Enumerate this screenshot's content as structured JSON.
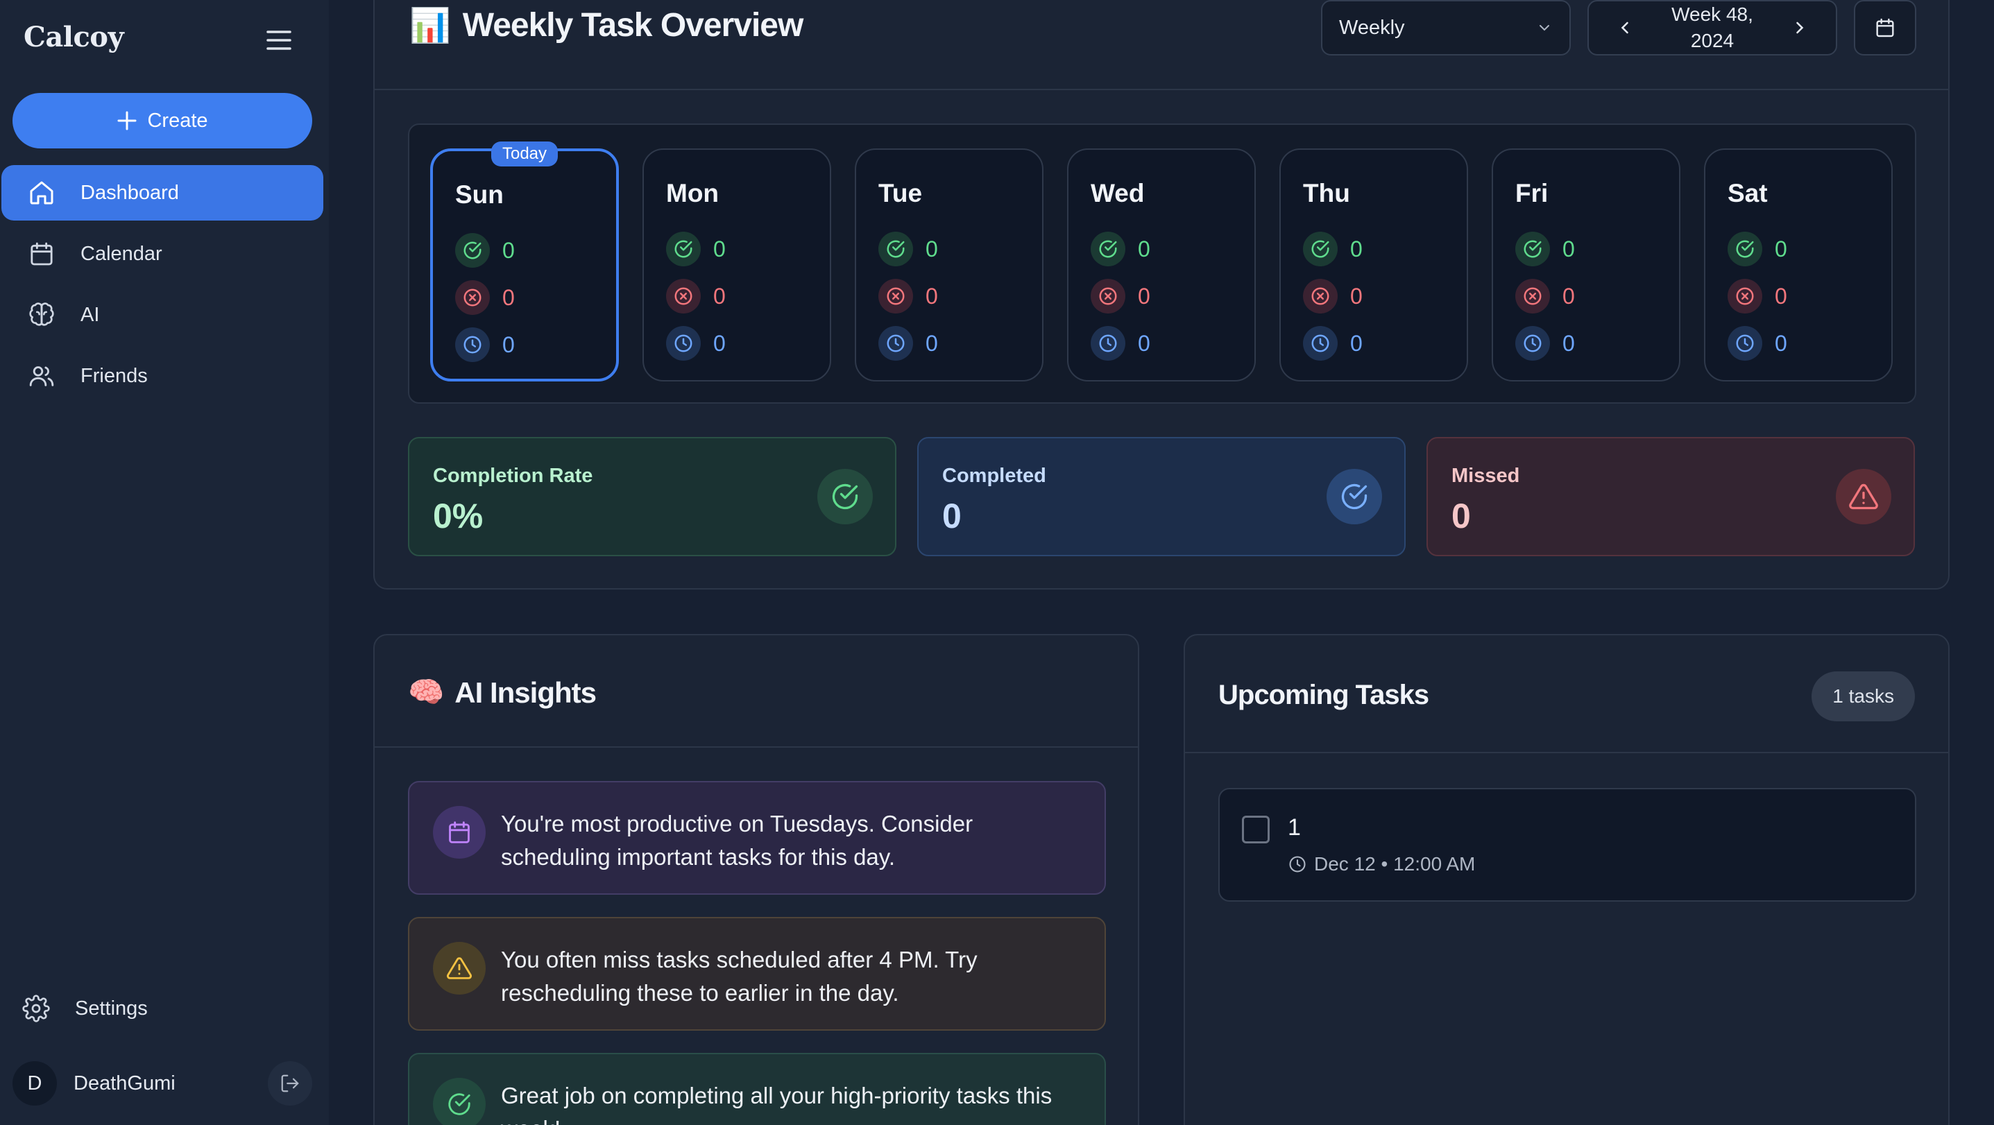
{
  "app": {
    "logo": "Calcoy",
    "create_label": "Create",
    "nav": [
      {
        "label": "Dashboard",
        "icon": "home-icon",
        "active": true
      },
      {
        "label": "Calendar",
        "icon": "calendar-icon",
        "active": false
      },
      {
        "label": "AI",
        "icon": "brain-icon",
        "active": false
      },
      {
        "label": "Friends",
        "icon": "users-icon",
        "active": false
      }
    ],
    "settings_label": "Settings",
    "user": {
      "initial": "D",
      "name": "DeathGumi"
    },
    "accent": "#3e7ef0"
  },
  "overview": {
    "title": "Weekly Task Overview",
    "title_icon": "📊",
    "view_select": "Weekly",
    "week_label_line1": "Week 48,",
    "week_label_line2": "2024",
    "today_badge": "Today",
    "days": [
      {
        "name": "Sun",
        "completed": "0",
        "missed": "0",
        "pending": "0"
      },
      {
        "name": "Mon",
        "completed": "0",
        "missed": "0",
        "pending": "0"
      },
      {
        "name": "Tue",
        "completed": "0",
        "missed": "0",
        "pending": "0"
      },
      {
        "name": "Wed",
        "completed": "0",
        "missed": "0",
        "pending": "0"
      },
      {
        "name": "Thu",
        "completed": "0",
        "missed": "0",
        "pending": "0"
      },
      {
        "name": "Fri",
        "completed": "0",
        "missed": "0",
        "pending": "0"
      },
      {
        "name": "Sat",
        "completed": "0",
        "missed": "0",
        "pending": "0"
      }
    ],
    "cards": {
      "completion_rate": {
        "label": "Completion Rate",
        "value": "0%"
      },
      "completed": {
        "label": "Completed",
        "value": "0"
      },
      "missed": {
        "label": "Missed",
        "value": "0"
      }
    }
  },
  "insights": {
    "title": "AI Insights",
    "title_icon": "🧠",
    "items": [
      {
        "text": "You're most productive on Tuesdays. Consider scheduling important tasks for this day.",
        "icon": "calendar-icon"
      },
      {
        "text": "You often miss tasks scheduled after 4 PM. Try rescheduling these to earlier in the day.",
        "icon": "warning-icon"
      },
      {
        "text": "Great job on completing all your high-priority tasks this week!",
        "icon": "check-circle-icon"
      }
    ]
  },
  "upcoming": {
    "title": "Upcoming Tasks",
    "count": "1 tasks",
    "tasks": [
      {
        "title": "1",
        "meta": "Dec 12 • 12:00 AM"
      }
    ]
  }
}
